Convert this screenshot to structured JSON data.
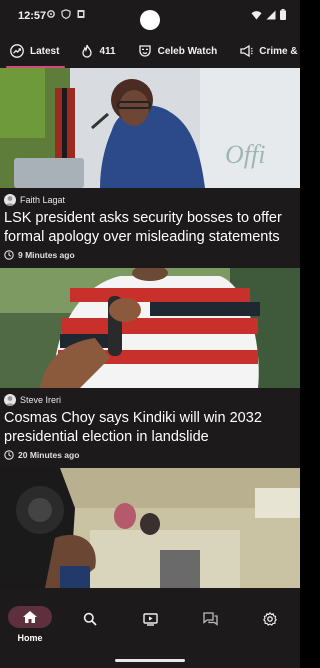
{
  "status_bar": {
    "time": "12:57",
    "left_icons": [
      "gear-icon",
      "shield-icon",
      "app-notification-icon"
    ],
    "right_icons": [
      "wifi-icon",
      "signal-icon",
      "battery-icon"
    ]
  },
  "tabs": [
    {
      "label": "Latest",
      "icon": "trending-icon",
      "active": true
    },
    {
      "label": "411",
      "icon": "flame-icon",
      "active": false
    },
    {
      "label": "Celeb Watch",
      "icon": "mask-icon",
      "active": false
    },
    {
      "label": "Crime & Scandal",
      "icon": "megaphone-icon",
      "active": false
    }
  ],
  "articles": [
    {
      "author": "Faith Lagat",
      "headline": "LSK president asks security bosses to offer formal apology over misleading statements",
      "time_ago": "9 Minutes ago"
    },
    {
      "author": "Steve Ireri",
      "headline": "Cosmas Choy says Kindiki will win 2032 presidential election in landslide",
      "time_ago": "20 Minutes ago"
    },
    {
      "author": "",
      "headline": "",
      "time_ago": ""
    }
  ],
  "bottom_nav": [
    {
      "label": "Home",
      "icon": "home-icon",
      "active": true
    },
    {
      "label": "",
      "icon": "search-icon",
      "active": false
    },
    {
      "label": "",
      "icon": "video-icon",
      "active": false
    },
    {
      "label": "",
      "icon": "chat-icon",
      "active": false
    },
    {
      "label": "",
      "icon": "settings-icon",
      "active": false
    }
  ],
  "colors": {
    "background": "#1d1a1b",
    "accent": "#d24e7e",
    "nav_pill": "#5e2f3c"
  }
}
